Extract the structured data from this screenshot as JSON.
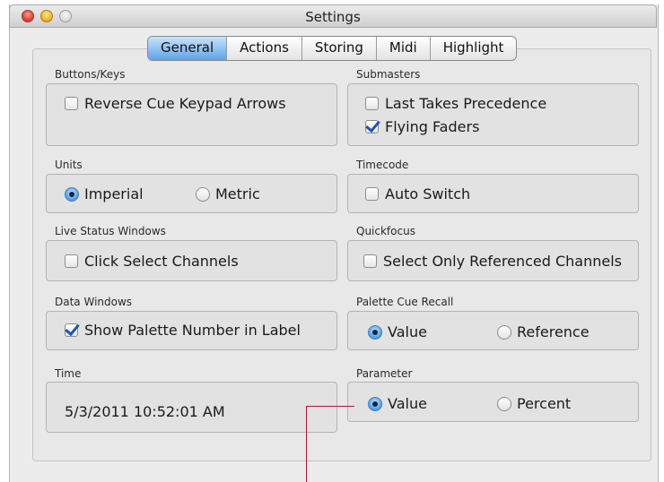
{
  "window": {
    "title": "Settings"
  },
  "tabs": [
    "General",
    "Actions",
    "Storing",
    "Midi",
    "Highlight"
  ],
  "groups": {
    "buttons_keys": {
      "label": "Buttons/Keys",
      "reverse_cue": "Reverse Cue Keypad Arrows"
    },
    "submasters": {
      "label": "Submasters",
      "last_takes": "Last Takes Precedence",
      "flying_faders": "Flying Faders"
    },
    "units": {
      "label": "Units",
      "imperial": "Imperial",
      "metric": "Metric"
    },
    "timecode": {
      "label": "Timecode",
      "auto_switch": "Auto Switch"
    },
    "live_status": {
      "label": "Live Status Windows",
      "click_select": "Click Select Channels"
    },
    "quickfocus": {
      "label": "Quickfocus",
      "select_only": "Select Only Referenced Channels"
    },
    "data_windows": {
      "label": "Data Windows",
      "show_palette": "Show Palette Number in Label"
    },
    "palette_cue_recall": {
      "label": "Palette Cue Recall",
      "value": "Value",
      "reference": "Reference"
    },
    "time": {
      "label": "Time",
      "value": "5/3/2011 10:52:01 AM"
    },
    "parameter": {
      "label": "Parameter",
      "value": "Value",
      "percent": "Percent"
    }
  },
  "state": {
    "active_tab": "General",
    "reverse_cue": false,
    "last_takes": false,
    "flying_faders": true,
    "units": "Imperial",
    "auto_switch": false,
    "click_select": false,
    "select_only": false,
    "show_palette": true,
    "palette_cue_recall": "Value",
    "parameter": "Value"
  }
}
